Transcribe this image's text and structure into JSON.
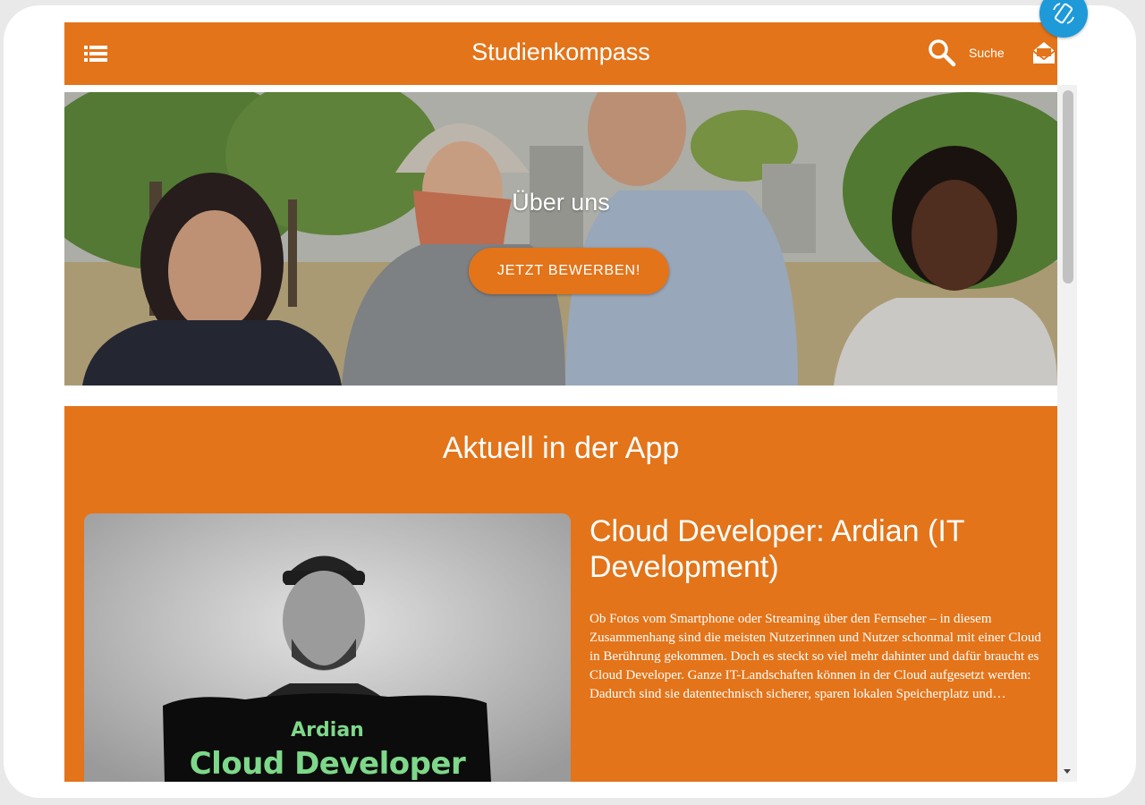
{
  "header": {
    "title": "Studienkompass",
    "search_label": "Suche",
    "icons": [
      "menu-icon",
      "search-icon",
      "inbox-icon"
    ]
  },
  "hero": {
    "title": "Über uns",
    "apply_button": "JETZT BEWERBEN!"
  },
  "section": {
    "title": "Aktuell in der App",
    "article": {
      "image_name": "Ardian",
      "image_role": "Cloud Developer",
      "title": "Cloud Developer: Ardian (IT Development)",
      "text": "Ob Fotos vom Smartphone oder Streaming über den Fernseher – in diesem Zusammenhang sind die meisten Nutzerinnen und Nutzer schonmal mit einer Cloud in Berührung gekommen. Doch es steckt so viel mehr dahinter und dafür braucht es Cloud Developer. Ganze IT-Landschaften können in der Cloud aufgesetzt werden: Dadurch sind sie datentechnisch sicherer, sparen lokalen Speicherplatz und…"
    }
  },
  "colors": {
    "brand_orange": "#e3741a",
    "rotate_blue": "#1e9ad9",
    "image_accent_green": "#7ed88a"
  }
}
